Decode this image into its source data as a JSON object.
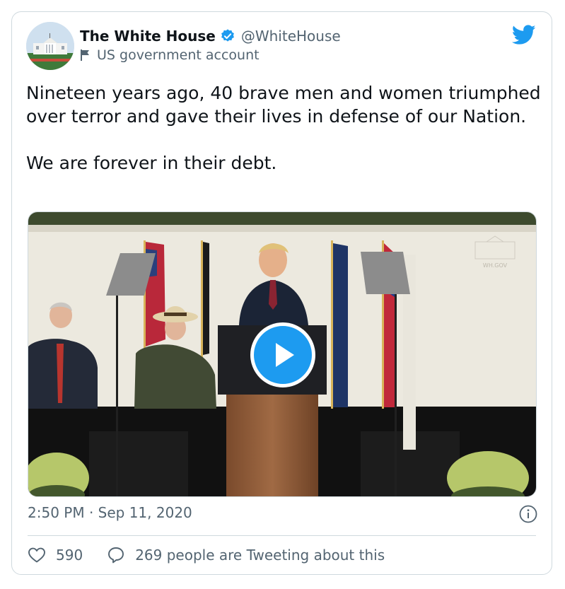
{
  "author": {
    "display_name": "The White House",
    "handle": "@WhiteHouse",
    "account_label": "US government account"
  },
  "tweet": {
    "text": "Nineteen years ago, 40 brave men and women triumphed over terror and gave their lives in defense of our Nation.\n\nWe are forever in their debt.",
    "timestamp": "2:50 PM · Sep 11, 2020"
  },
  "media": {
    "watermark": "WH.GOV",
    "type": "video"
  },
  "engagement": {
    "likes": "590",
    "tweeting_text": "269 people are Tweeting about this"
  },
  "colors": {
    "accent": "#1d9bf0",
    "text_primary": "#0f1419",
    "text_secondary": "#536471",
    "border": "#cfd9de"
  },
  "icons": {
    "verified": "verified-badge-icon",
    "label": "flag-icon",
    "brand": "twitter-bird-icon",
    "play": "play-icon",
    "info": "info-icon",
    "like": "heart-icon",
    "reply": "speech-bubble-icon"
  }
}
